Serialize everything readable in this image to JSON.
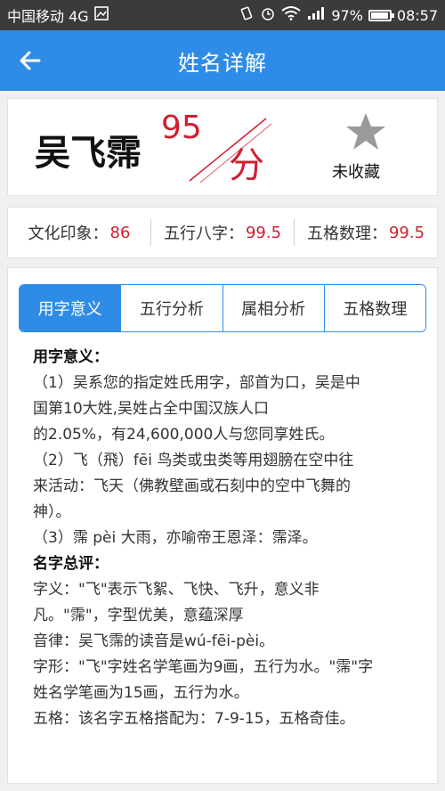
{
  "status_bar": {
    "carrier": "中国移动 4G",
    "battery": "97%",
    "battery_level": 0.97,
    "time": "08:57",
    "icons": [
      "image-icon",
      "vibrate-icon",
      "alarm-icon",
      "wifi-icon",
      "signal-icon",
      "battery-icon"
    ]
  },
  "app_bar": {
    "title": "姓名详解",
    "back_icon": "back-arrow-icon"
  },
  "name_card": {
    "name": "吴飞霈",
    "score": "95",
    "score_unit": "分",
    "favorite_label": "未收藏",
    "favorite_icon": "star-icon"
  },
  "score_row": [
    {
      "label": "文化印象：",
      "value": "86"
    },
    {
      "label": "五行八字：",
      "value": "99.5"
    },
    {
      "label": "五格数理：",
      "value": "99.5"
    }
  ],
  "tabs": [
    {
      "label": "用字意义",
      "active": true
    },
    {
      "label": "五行分析",
      "active": false
    },
    {
      "label": "属相分析",
      "active": false
    },
    {
      "label": "五格数理",
      "active": false
    }
  ],
  "content": {
    "heading1": "用字意义：",
    "lines1": [
      "（1）吴系您的指定姓氏用字，部首为口，吴是中",
      "国第10大姓,吴姓占全中国汉族人口",
      "的2.05%，有24,600,000人与您同享姓氏。",
      "（2）飞（飛）fēi 鸟类或虫类等用翅膀在空中往",
      "来活动：飞天（佛教壁画或石刻中的空中飞舞的",
      "神）。",
      "（3）霈 pèi 大雨，亦喻帝王恩泽：霈泽。"
    ],
    "heading2": "名字总评：",
    "lines2": [
      "字义：\"飞\"表示飞絮、飞快、飞升，意义非",
      "凡。\"霈\"，字型优美，意蕴深厚",
      "音律：吴飞霈的读音是wú-fēi-pèi。",
      "字形：\"飞\"字姓名学笔画为9画，五行为水。\"霈\"字",
      "姓名学笔画为15画，五行为水。",
      "五格：该名字五格搭配为：7-9-15，五格奇佳。"
    ]
  },
  "colors": {
    "accent": "#2f8ce6",
    "score_red": "#d01f2f",
    "status_bar": "#3b3b3b"
  }
}
